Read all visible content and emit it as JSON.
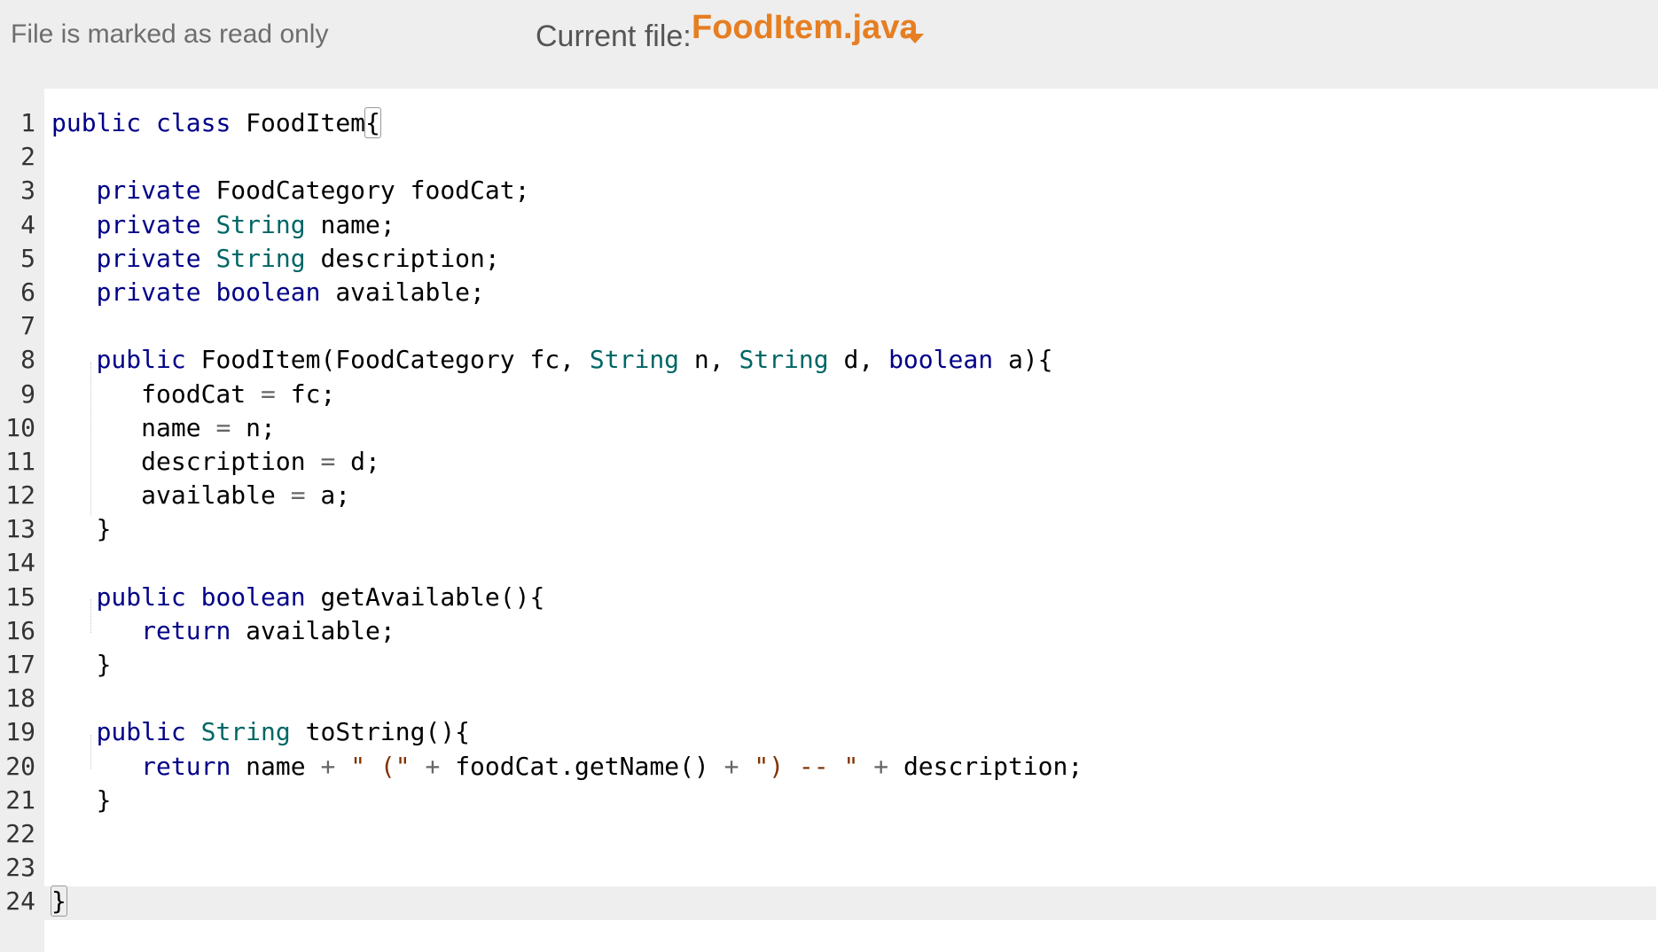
{
  "header": {
    "readonly_text": "File is marked as read only",
    "current_file_label": "Current file:",
    "current_file_name": "FoodItem.java",
    "dropdown_icon": "caret-down-icon",
    "accent_color": "#e67e22"
  },
  "editor": {
    "lines": [
      {
        "num": "1",
        "tokens": [
          [
            "keyword",
            "public"
          ],
          [
            "ident",
            " "
          ],
          [
            "keyword",
            "class"
          ],
          [
            "ident",
            " FoodItem"
          ],
          [
            "bracket",
            "{"
          ]
        ]
      },
      {
        "num": "2",
        "tokens": []
      },
      {
        "num": "3",
        "tokens": [
          [
            "ident",
            "   "
          ],
          [
            "keyword",
            "private"
          ],
          [
            "ident",
            " FoodCategory foodCat;"
          ]
        ]
      },
      {
        "num": "4",
        "tokens": [
          [
            "ident",
            "   "
          ],
          [
            "keyword",
            "private"
          ],
          [
            "ident",
            " "
          ],
          [
            "type",
            "String"
          ],
          [
            "ident",
            " name;"
          ]
        ]
      },
      {
        "num": "5",
        "tokens": [
          [
            "ident",
            "   "
          ],
          [
            "keyword",
            "private"
          ],
          [
            "ident",
            " "
          ],
          [
            "type",
            "String"
          ],
          [
            "ident",
            " description;"
          ]
        ]
      },
      {
        "num": "6",
        "tokens": [
          [
            "ident",
            "   "
          ],
          [
            "keyword",
            "private"
          ],
          [
            "ident",
            " "
          ],
          [
            "keyword",
            "boolean"
          ],
          [
            "ident",
            " available;"
          ]
        ]
      },
      {
        "num": "7",
        "tokens": []
      },
      {
        "num": "8",
        "tokens": [
          [
            "ident",
            "   "
          ],
          [
            "keyword",
            "public"
          ],
          [
            "ident",
            " FoodItem(FoodCategory fc, "
          ],
          [
            "type",
            "String"
          ],
          [
            "ident",
            " n, "
          ],
          [
            "type",
            "String"
          ],
          [
            "ident",
            " d, "
          ],
          [
            "keyword",
            "boolean"
          ],
          [
            "ident",
            " a){"
          ]
        ]
      },
      {
        "num": "9",
        "tokens": [
          [
            "ident",
            "      foodCat "
          ],
          [
            "op",
            "="
          ],
          [
            "ident",
            " fc;"
          ]
        ]
      },
      {
        "num": "10",
        "tokens": [
          [
            "ident",
            "      name "
          ],
          [
            "op",
            "="
          ],
          [
            "ident",
            " n;"
          ]
        ]
      },
      {
        "num": "11",
        "tokens": [
          [
            "ident",
            "      description "
          ],
          [
            "op",
            "="
          ],
          [
            "ident",
            " d;"
          ]
        ]
      },
      {
        "num": "12",
        "tokens": [
          [
            "ident",
            "      available "
          ],
          [
            "op",
            "="
          ],
          [
            "ident",
            " a;"
          ]
        ]
      },
      {
        "num": "13",
        "tokens": [
          [
            "ident",
            "   }"
          ]
        ]
      },
      {
        "num": "14",
        "tokens": []
      },
      {
        "num": "15",
        "tokens": [
          [
            "ident",
            "   "
          ],
          [
            "keyword",
            "public"
          ],
          [
            "ident",
            " "
          ],
          [
            "keyword",
            "boolean"
          ],
          [
            "ident",
            " getAvailable(){"
          ]
        ]
      },
      {
        "num": "16",
        "tokens": [
          [
            "ident",
            "      "
          ],
          [
            "keyword",
            "return"
          ],
          [
            "ident",
            " available;"
          ]
        ]
      },
      {
        "num": "17",
        "tokens": [
          [
            "ident",
            "   }"
          ]
        ]
      },
      {
        "num": "18",
        "tokens": []
      },
      {
        "num": "19",
        "tokens": [
          [
            "ident",
            "   "
          ],
          [
            "keyword",
            "public"
          ],
          [
            "ident",
            " "
          ],
          [
            "type",
            "String"
          ],
          [
            "ident",
            " toString(){"
          ]
        ]
      },
      {
        "num": "20",
        "tokens": [
          [
            "ident",
            "      "
          ],
          [
            "keyword",
            "return"
          ],
          [
            "ident",
            " name "
          ],
          [
            "op",
            "+"
          ],
          [
            "ident",
            " "
          ],
          [
            "str",
            "\" (\""
          ],
          [
            "ident",
            " "
          ],
          [
            "op",
            "+"
          ],
          [
            "ident",
            " foodCat.getName() "
          ],
          [
            "op",
            "+"
          ],
          [
            "ident",
            " "
          ],
          [
            "str",
            "\") -- \""
          ],
          [
            "ident",
            " "
          ],
          [
            "op",
            "+"
          ],
          [
            "ident",
            " description;"
          ]
        ]
      },
      {
        "num": "21",
        "tokens": [
          [
            "ident",
            "   }"
          ]
        ]
      },
      {
        "num": "22",
        "tokens": []
      },
      {
        "num": "23",
        "tokens": []
      },
      {
        "num": "24",
        "tokens": [
          [
            "bracket",
            "}"
          ]
        ]
      }
    ]
  }
}
